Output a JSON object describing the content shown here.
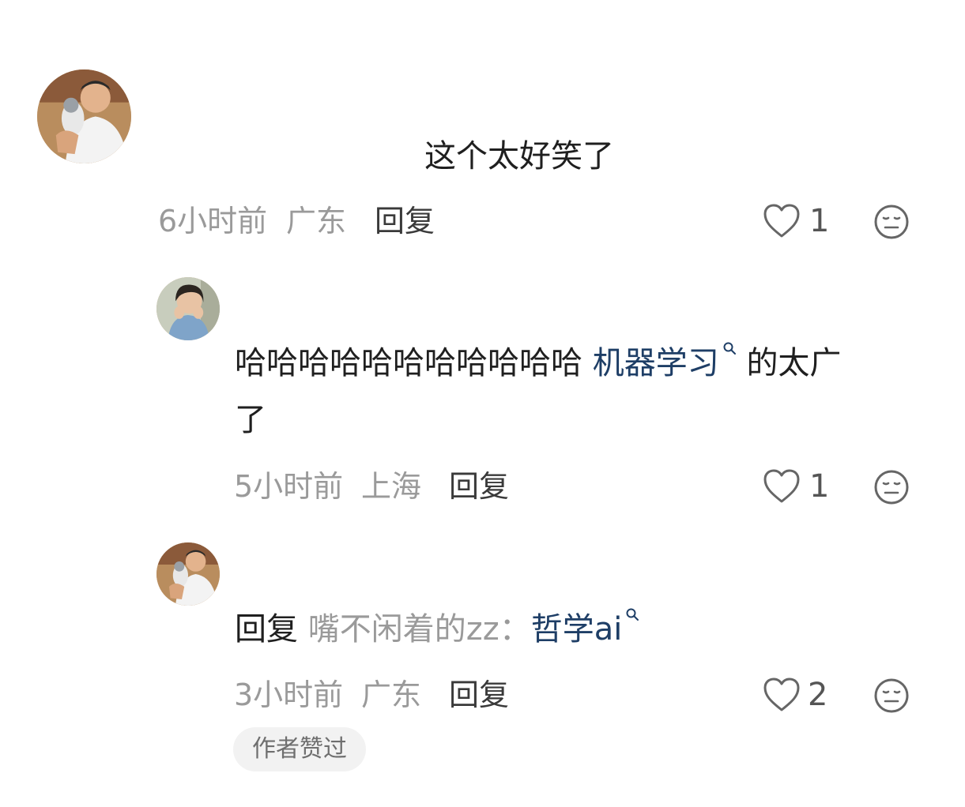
{
  "comments": [
    {
      "text": "这个太好笑了",
      "time": "6小时前",
      "location": "广东",
      "reply_label": "回复",
      "likes": "1",
      "avatar_icon": "user-avatar-photo"
    },
    {
      "text_prefix": "哈哈哈哈哈哈哈哈哈哈哈",
      "link_text": "机器学习",
      "text_middle": "的太广",
      "text_line2": "了",
      "time": "5小时前",
      "location": "上海",
      "reply_label": "回复",
      "likes": "1",
      "avatar_icon": "user-avatar-photo"
    },
    {
      "reply_prefix": "回复",
      "reply_to_user": "嘴不闲着的zz：",
      "link_text": "哲学ai",
      "time": "3小时前",
      "location": "广东",
      "reply_label": "回复",
      "likes": "2",
      "author_badge": "作者赞过",
      "avatar_icon": "user-avatar-photo"
    }
  ],
  "icons": {
    "like": "heart-outline-icon",
    "dislike": "neutral-face-icon",
    "search": "search-icon"
  },
  "colors": {
    "link": "#1e3e66",
    "meta": "#9a9a9a",
    "text": "#1f1f1f"
  }
}
